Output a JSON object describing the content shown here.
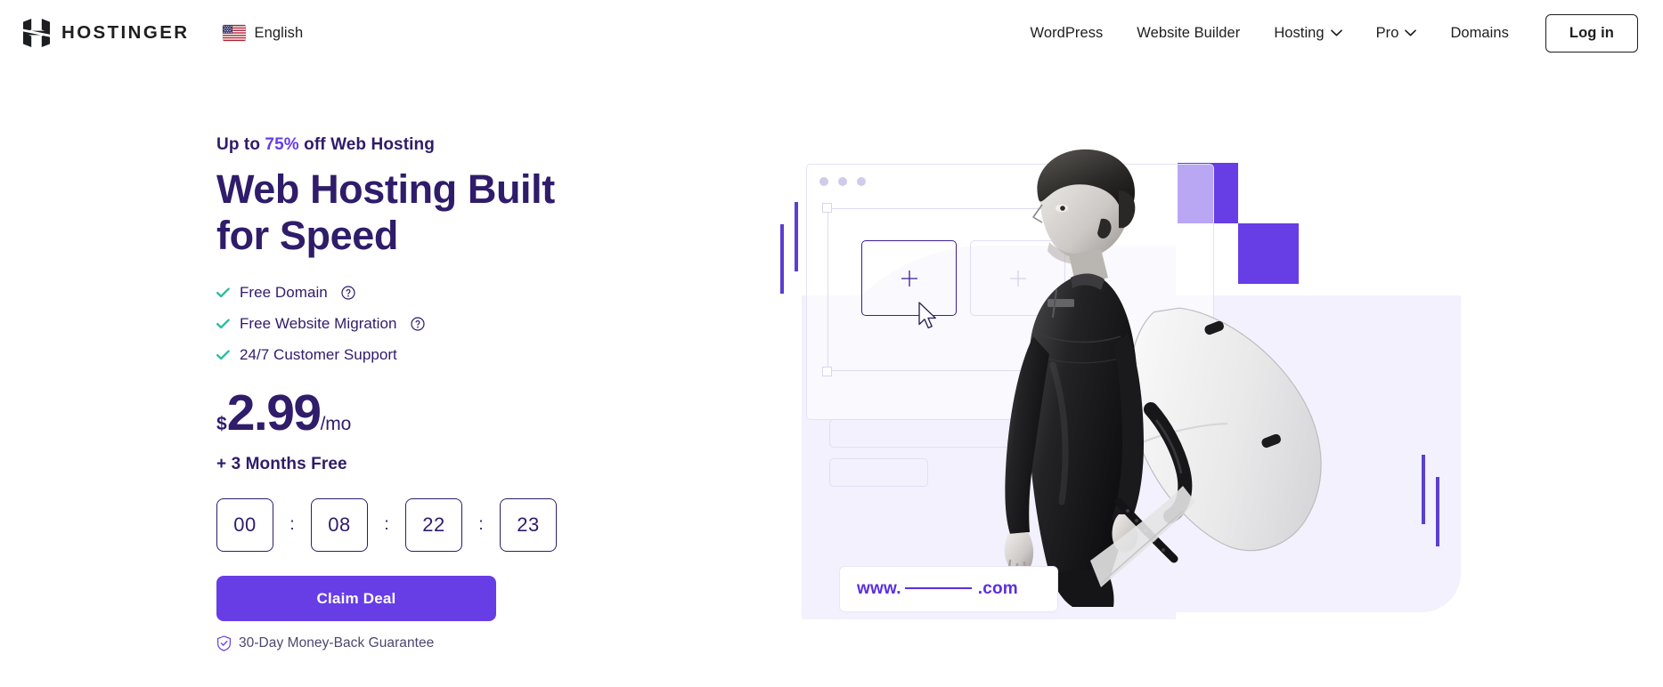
{
  "header": {
    "logo_icon": "hostinger-h-logo",
    "logo_text": "HOSTINGER",
    "language": {
      "flag_icon": "us-flag-icon",
      "label": "English"
    },
    "nav_items": [
      {
        "label": "WordPress",
        "has_caret": false
      },
      {
        "label": "Website Builder",
        "has_caret": false
      },
      {
        "label": "Hosting",
        "has_caret": true
      },
      {
        "label": "Pro",
        "has_caret": true
      },
      {
        "label": "Domains",
        "has_caret": false
      }
    ],
    "login_label": "Log in"
  },
  "hero": {
    "eyebrow_prefix": "Up to ",
    "eyebrow_percent": "75%",
    "eyebrow_suffix": " off Web Hosting",
    "headline": "Web Hosting Built for Speed",
    "features": [
      {
        "label": "Free Domain",
        "icon": "check-icon",
        "has_help": true
      },
      {
        "label": "Free Website Migration",
        "icon": "check-icon",
        "has_help": true
      },
      {
        "label": "24/7 Customer Support",
        "icon": "check-icon",
        "has_help": false
      }
    ],
    "price": {
      "currency": "$",
      "amount": "2.99",
      "period": "/mo"
    },
    "bonus": "+ 3 Months Free",
    "countdown": {
      "days": "00",
      "hours": "08",
      "minutes": "22",
      "seconds": "23",
      "separator": ":"
    },
    "cta_label": "Claim Deal",
    "guarantee": {
      "icon": "shield-check-icon",
      "label": "30-Day Money-Back Guarantee"
    }
  },
  "artwork": {
    "browser_mock": {
      "window_dots": 3,
      "card_a_icon": "plus-icon",
      "card_b_icon": "plus-icon",
      "cursor_icon": "mouse-pointer-icon"
    },
    "domain_bar": {
      "prefix": "www.",
      "suffix": ".com"
    },
    "photo_alt": "surfer-holding-board-photo",
    "squares": 2,
    "accent_bars": 4
  },
  "colors": {
    "brand_purple": "#673de6",
    "deep_purple": "#2f1c6a",
    "link_purple": "#5b2ee0",
    "teal_check": "#2ebda4",
    "lavender_panel": "#f2f1fd",
    "text_dark": "#1d1e20",
    "muted_text": "#4b476e"
  }
}
